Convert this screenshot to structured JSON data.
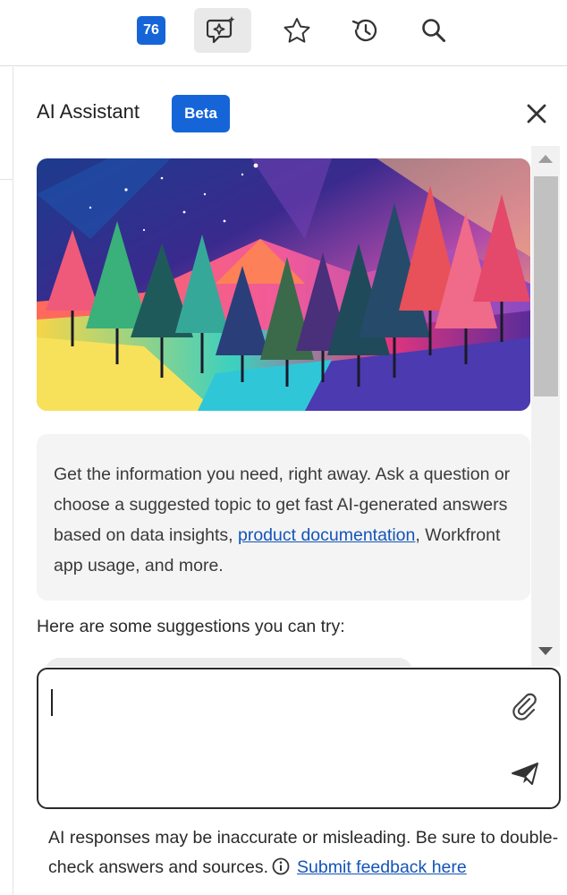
{
  "toolbar": {
    "badge_count": "76",
    "buttons": [
      "ai-assistant",
      "favorites",
      "recent",
      "search"
    ]
  },
  "panel": {
    "title": "AI Assistant",
    "badge": "Beta",
    "intro_before_link": "Get the information you need, right away. Ask a question or choose a suggested topic to get fast AI-generated answers based on data insights, ",
    "intro_link": "product documentation",
    "intro_after_link": ", Workfront app usage, and more.",
    "suggestions_title": "Here are some suggestions you can try:"
  },
  "composer": {
    "value": "",
    "placeholder": ""
  },
  "disclaimer": {
    "text": "AI responses may be inaccurate or misleading. Be sure to double-check answers and sources.",
    "feedback_link": "Submit feedback here"
  },
  "colors": {
    "accent": "#1565d8",
    "link": "#1454b8"
  }
}
